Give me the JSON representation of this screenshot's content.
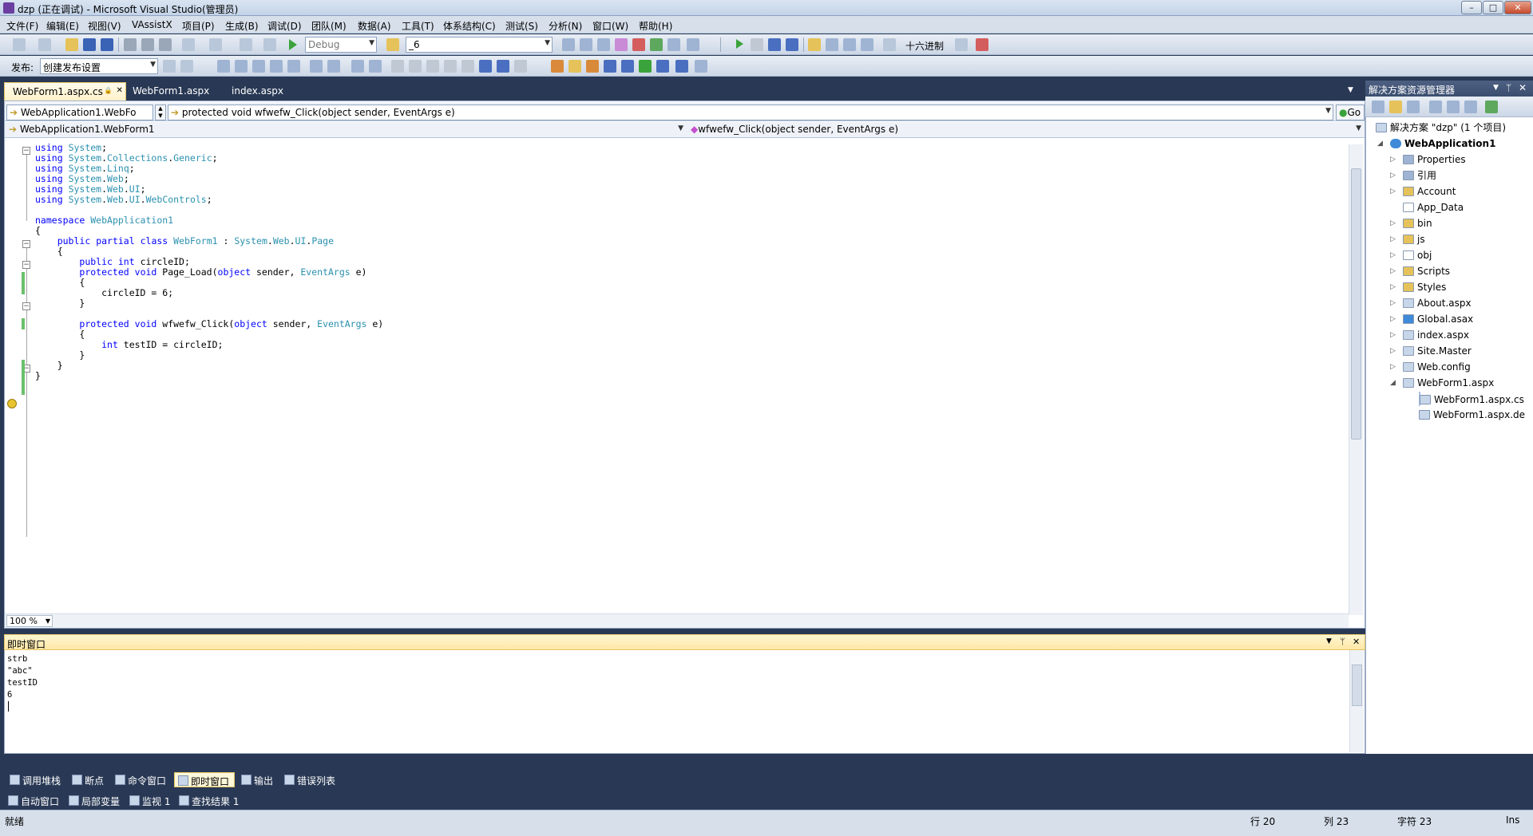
{
  "window": {
    "title": "dzp (正在调试) - Microsoft Visual Studio(管理员)",
    "min": "–",
    "max": "□",
    "close": "✕"
  },
  "menu": [
    "文件(F)",
    "编辑(E)",
    "视图(V)",
    "VAssistX",
    "项目(P)",
    "生成(B)",
    "调试(D)",
    "团队(M)",
    "数据(A)",
    "工具(T)",
    "体系结构(C)",
    "测试(S)",
    "分析(N)",
    "窗口(W)",
    "帮助(H)"
  ],
  "toolbar1": {
    "config": "Debug",
    "find_value": "_6",
    "hex_label": "十六进制"
  },
  "toolbar2": {
    "publish_label": "发布:",
    "publish_value": "创建发布设置"
  },
  "tabs": [
    {
      "label": "WebForm1.aspx.cs",
      "active": true,
      "pin": "🔒",
      "close": "✕"
    },
    {
      "label": "WebForm1.aspx"
    },
    {
      "label": "index.aspx"
    }
  ],
  "nav1": {
    "left": "WebApplication1.WebFo",
    "right": "protected void wfwefw_Click(object sender, EventArgs e)",
    "go": "Go"
  },
  "nav2": {
    "left": "WebApplication1.WebForm1",
    "right": "wfwefw_Click(object sender, EventArgs e)"
  },
  "code": [
    "using System;",
    "using System.Collections.Generic;",
    "using System.Linq;",
    "using System.Web;",
    "using System.Web.UI;",
    "using System.Web.UI.WebControls;",
    "",
    "namespace WebApplication1",
    "{",
    "    public partial class WebForm1 : System.Web.UI.Page",
    "    {",
    "        public int circleID;",
    "        protected void Page_Load(object sender, EventArgs e)",
    "        {",
    "            circleID = 6;",
    "        }",
    "",
    "        protected void wfwefw_Click(object sender, EventArgs e)",
    "        {",
    "            int testID = circleID;",
    "        }",
    "    }",
    "}"
  ],
  "zoom": "100 %",
  "immediate": {
    "title": "即时窗口",
    "lines": "strb\n\"abc\"\ntestID\n6\n"
  },
  "bottom_tabs": [
    "调用堆栈",
    "断点",
    "命令窗口",
    "即时窗口",
    "输出",
    "错误列表"
  ],
  "bottom_tabs2": [
    "自动窗口",
    "局部变量",
    "监视 1",
    "查找结果 1"
  ],
  "solution": {
    "title": "解决方案资源管理器",
    "root": "解决方案 \"dzp\" (1 个项目)",
    "project": "WebApplication1",
    "items": [
      "Properties",
      "引用",
      "Account",
      "App_Data",
      "bin",
      "js",
      "obj",
      "Scripts",
      "Styles",
      "About.aspx",
      "Global.asax",
      "index.aspx",
      "Site.Master",
      "Web.config",
      "WebForm1.aspx"
    ],
    "children": [
      "WebForm1.aspx.cs",
      "WebForm1.aspx.de"
    ]
  },
  "status": {
    "ready": "就绪",
    "line": "行 20",
    "col": "列 23",
    "ch": "字符 23",
    "mode": "Ins"
  }
}
